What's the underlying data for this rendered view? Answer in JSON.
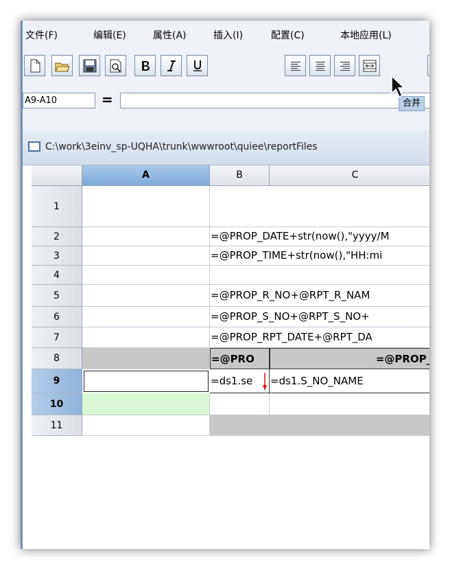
{
  "menu": {
    "file": "文件(F)",
    "edit": "编辑(E)",
    "properties": "属性(A)",
    "insert": "插入(I)",
    "config": "配置(C)",
    "local_app": "本地应用(L)"
  },
  "formula_bar": {
    "cell_ref": "A9-A10",
    "equals_sign": "=",
    "formula_value": "",
    "tooltip": "合并"
  },
  "document": {
    "path": "C:\\work\\3einv_sp-UQHA\\trunk\\wwwroot\\quiee\\reportFiles"
  },
  "sheet": {
    "columns": [
      "A",
      "B",
      "C"
    ],
    "rows": [
      "1",
      "2",
      "3",
      "4",
      "5",
      "6",
      "7",
      "8",
      "9",
      "10",
      "11"
    ],
    "cells": {
      "r2": "=@PROP_DATE+str(now(),\"yyyy/M",
      "r3": "=@PROP_TIME+str(now(),\"HH:mi",
      "r5": "=@PROP_R_NO+@RPT_R_NAM",
      "r6": "=@PROP_S_NO+@RPT_S_NO+",
      "r7": "=@PROP_RPT_DATE+@RPT_DA",
      "r8b": "=@PRO",
      "r8c": "=@PROP_S",
      "r9b": "=ds1.se",
      "r9c": "=ds1.S_NO_NAME"
    }
  },
  "colors": {
    "accent_selected_header": "#7eaad8",
    "selected_range_fill": "#d9f7d4",
    "gray_cells": "#c8c8c8",
    "window_frame": "#6f8fba"
  }
}
